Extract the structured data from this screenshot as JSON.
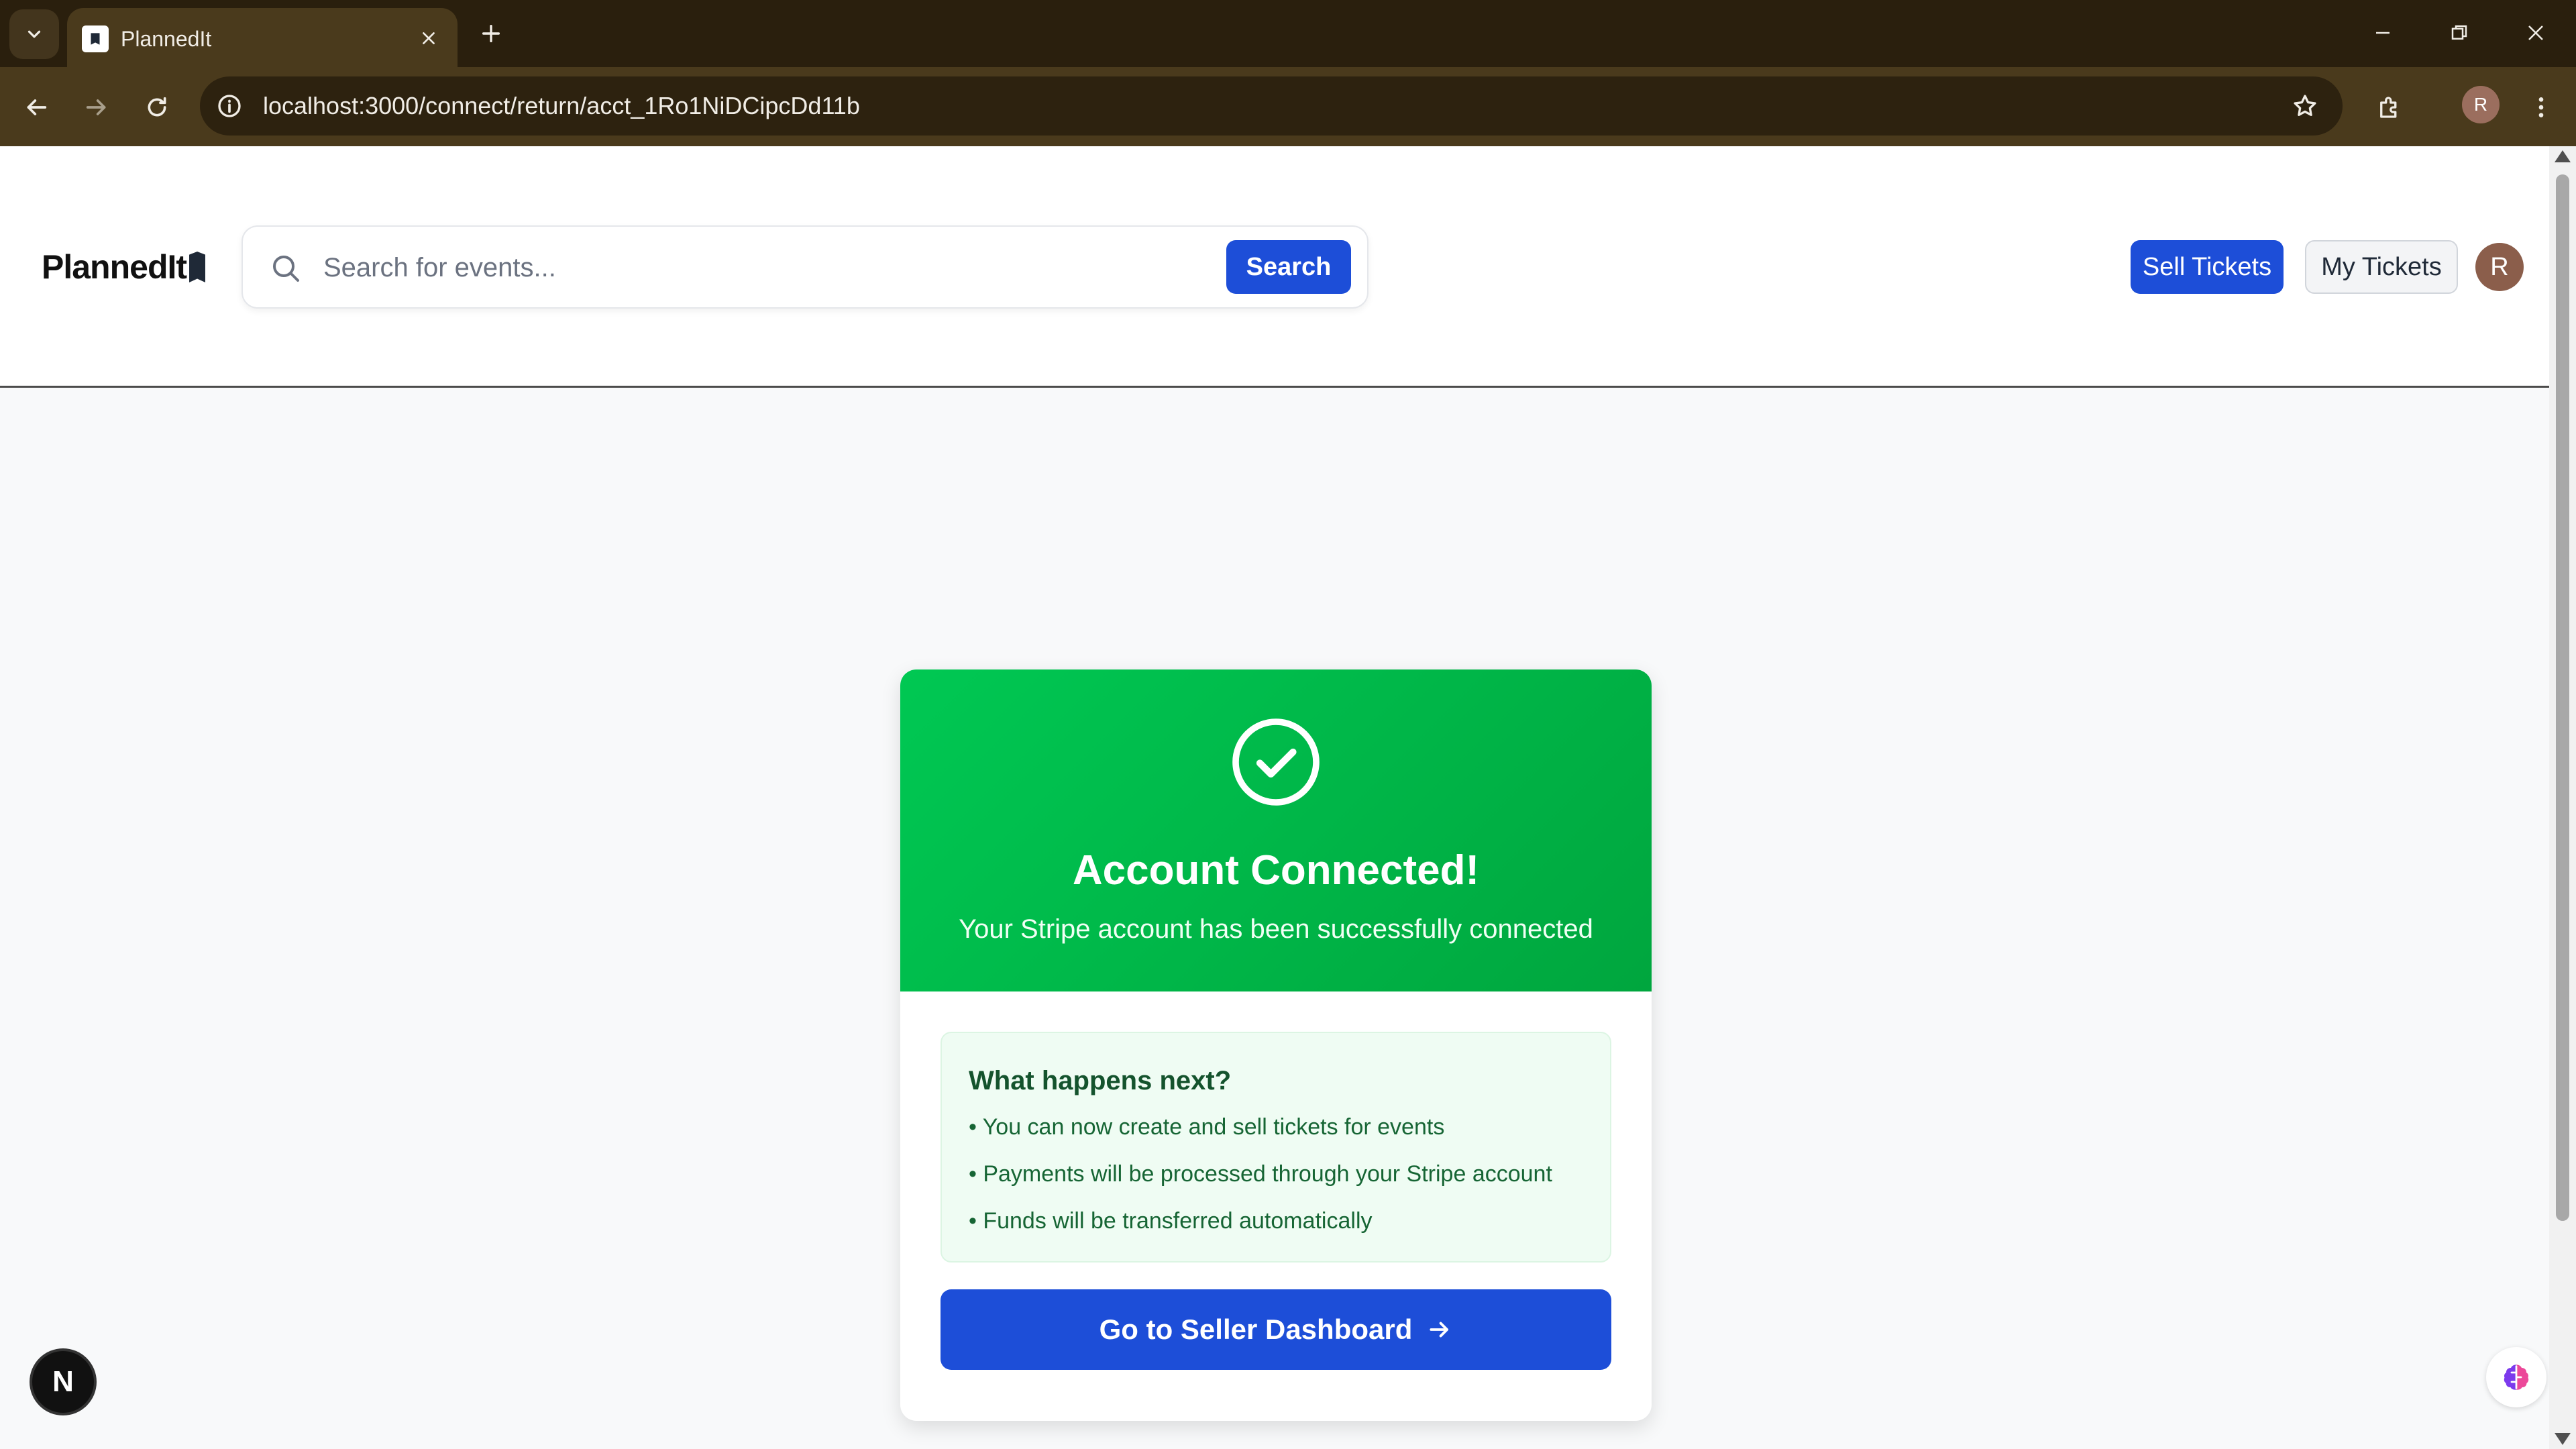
{
  "browser": {
    "tab": {
      "title": "PlannedIt"
    },
    "address": {
      "url": "localhost:3000/connect/return/acct_1Ro1NiDCipcDd11b"
    },
    "profile_initial": "R"
  },
  "header": {
    "logo_text": "PlannedIt",
    "search": {
      "placeholder": "Search for events...",
      "value": "",
      "button_label": "Search"
    },
    "sell_tickets_label": "Sell Tickets",
    "my_tickets_label": "My Tickets",
    "avatar_initial": "R"
  },
  "card": {
    "title": "Account Connected!",
    "subtitle": "Your Stripe account has been successfully connected",
    "next": {
      "title": "What happens next?",
      "items": [
        "• You can now create and sell tickets for events",
        "• Payments will be processed through your Stripe account",
        "• Funds will be transferred automatically"
      ]
    },
    "dashboard_button_label": "Go to Seller Dashboard"
  },
  "dev_badge_letter": "N",
  "colors": {
    "primary": "#1d4ed8",
    "success_start": "#00c853",
    "success_end": "#00a63e",
    "next_box_bg": "#effcf3",
    "chrome_bg": "#4a3a1c"
  },
  "icons": [
    "chevron-down-icon",
    "close-icon",
    "plus-icon",
    "minimize-icon",
    "restore-icon",
    "back-icon",
    "forward-icon",
    "reload-icon",
    "info-icon",
    "star-icon",
    "extensions-icon",
    "menu-dots-icon",
    "search-icon",
    "check-circle-icon",
    "arrow-right-icon",
    "brain-icon"
  ]
}
